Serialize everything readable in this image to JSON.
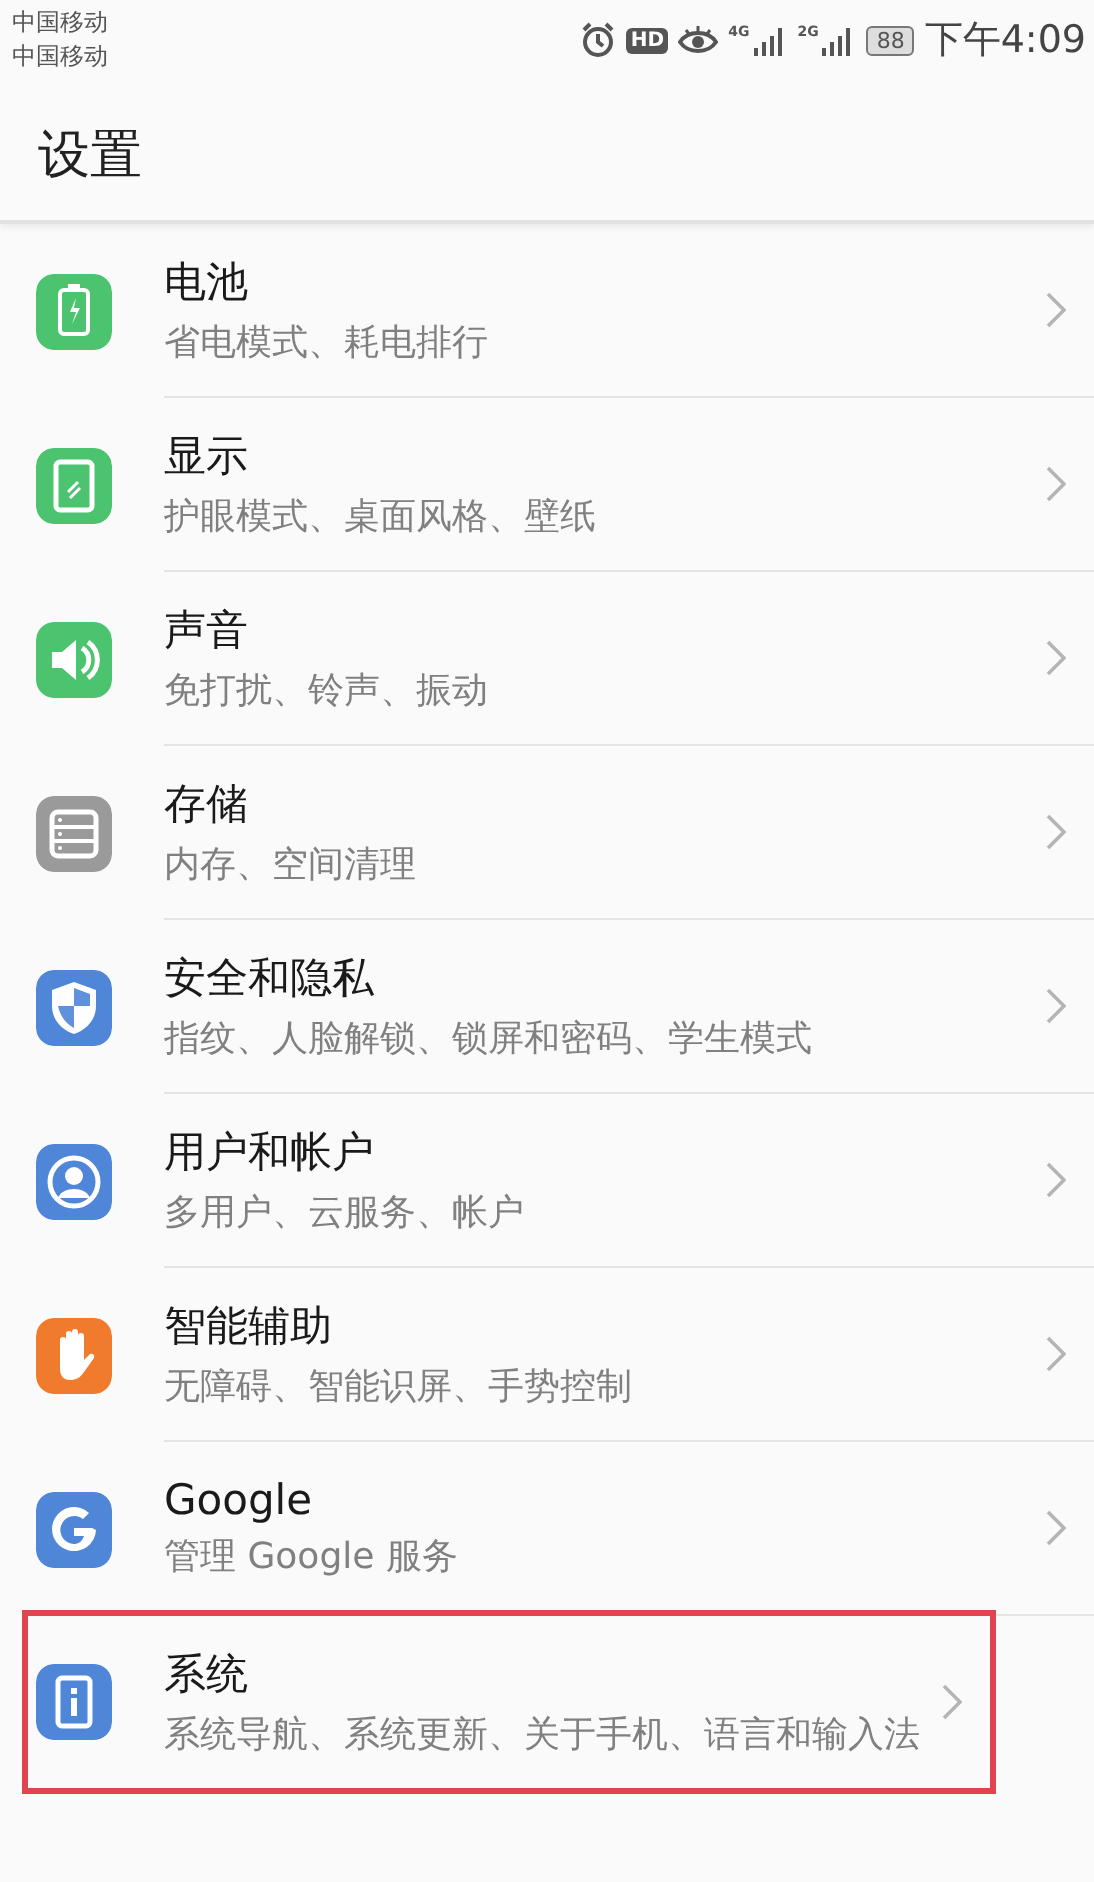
{
  "status_bar": {
    "carriers": [
      "中国移动",
      "中国移动"
    ],
    "hd": "HD",
    "network_1": "4G",
    "network_2": "2G",
    "battery": "88",
    "time": "下午4:09"
  },
  "title": "设置",
  "items": [
    {
      "kind": "battery",
      "color": "#4cc36e",
      "title": "电池",
      "subtitle": "省电模式、耗电排行",
      "highlighted": false
    },
    {
      "kind": "display",
      "color": "#4cc36e",
      "title": "显示",
      "subtitle": "护眼模式、桌面风格、壁纸",
      "highlighted": false
    },
    {
      "kind": "sound",
      "color": "#4cc36e",
      "title": "声音",
      "subtitle": "免打扰、铃声、振动",
      "highlighted": false
    },
    {
      "kind": "storage",
      "color": "#9a9a9a",
      "title": "存储",
      "subtitle": "内存、空间清理",
      "highlighted": false
    },
    {
      "kind": "security",
      "color": "#4f86d8",
      "title": "安全和隐私",
      "subtitle": "指纹、人脸解锁、锁屏和密码、学生模式",
      "highlighted": false
    },
    {
      "kind": "users",
      "color": "#4f86d8",
      "title": "用户和帐户",
      "subtitle": "多用户、云服务、帐户",
      "highlighted": false
    },
    {
      "kind": "assist",
      "color": "#f07b2c",
      "title": "智能辅助",
      "subtitle": "无障碍、智能识屏、手势控制",
      "highlighted": false
    },
    {
      "kind": "google",
      "color": "#4f86d8",
      "title": "Google",
      "subtitle": "管理 Google 服务",
      "highlighted": false
    },
    {
      "kind": "system",
      "color": "#4f86d8",
      "title": "系统",
      "subtitle": "系统导航、系统更新、关于手机、语言和输入法",
      "highlighted": true
    }
  ]
}
